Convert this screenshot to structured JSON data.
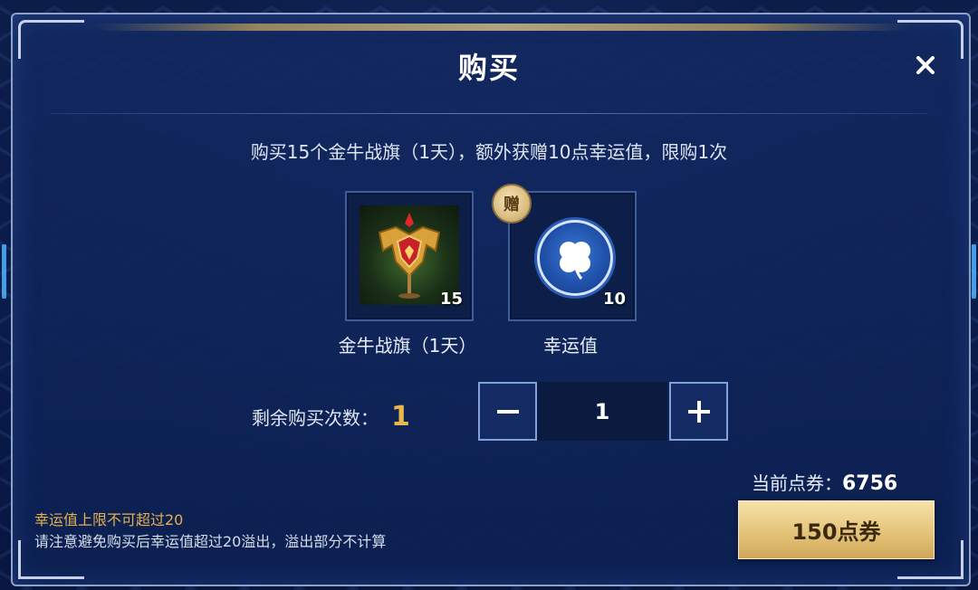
{
  "dialog": {
    "title": "购买",
    "description": "购买15个金牛战旗（1天），额外获赠10点幸运值，限购1次"
  },
  "items": [
    {
      "name": "金牛战旗（1天）",
      "count": "15",
      "icon": "banner-icon"
    },
    {
      "name": "幸运值",
      "count": "10",
      "icon": "clover-icon",
      "badge": "赠"
    }
  ],
  "purchase": {
    "remaining_label": "剩余购买次数：",
    "remaining_value": "1",
    "quantity": "1"
  },
  "balance": {
    "label": "当前点券：",
    "value": "6756"
  },
  "buy_button": {
    "label": "150点券"
  },
  "notes": {
    "warning": "幸运值上限不可超过20",
    "hint": "请注意避免购买后幸运值超过20溢出，溢出部分不计算"
  },
  "colors": {
    "accent_gold": "#e9b74b",
    "panel_blue": "#12285f",
    "button_gold": "#e4c47a"
  }
}
